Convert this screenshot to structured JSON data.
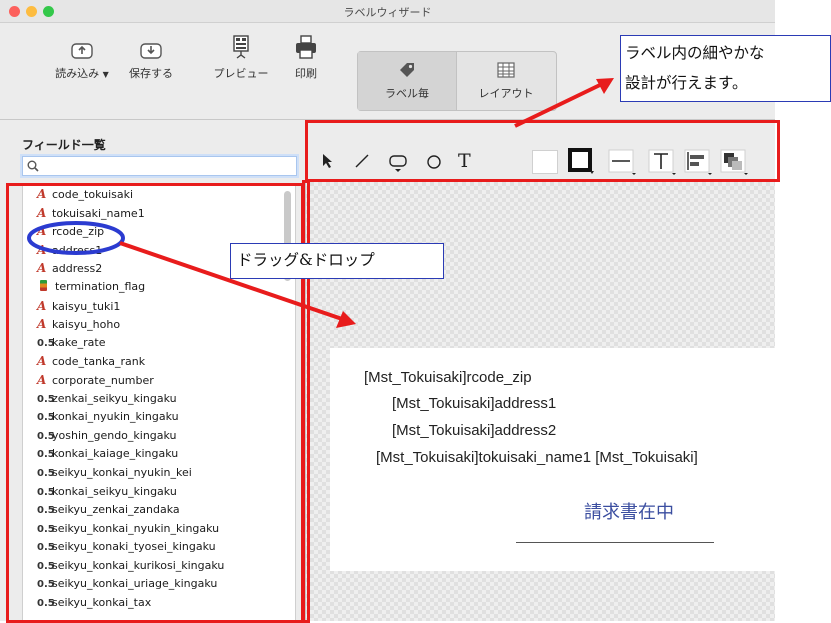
{
  "window": {
    "title": "ラベルウィザード",
    "traffic_lights": [
      "#fc605c",
      "#fdbc40",
      "#34c84a"
    ]
  },
  "toolbar": {
    "load_label": "読み込み",
    "save_label": "保存する",
    "preview_label": "プレビュー",
    "print_label": "印刷",
    "per_label_label": "ラベル毎",
    "layout_label": "レイアウト"
  },
  "sidebar": {
    "title": "フィールド一覧",
    "search_placeholder": "",
    "fields": [
      {
        "name": "code_tokuisaki",
        "icon": "A"
      },
      {
        "name": "tokuisaki_name1",
        "icon": "A"
      },
      {
        "name": "rcode_zip",
        "icon": "A"
      },
      {
        "name": "address1",
        "icon": "A"
      },
      {
        "name": "address2",
        "icon": "A"
      },
      {
        "name": "termination_flag",
        "icon": "flag"
      },
      {
        "name": "kaisyu_tuki1",
        "icon": "A"
      },
      {
        "name": "kaisyu_hoho",
        "icon": "A"
      },
      {
        "name": "kake_rate",
        "icon": "0.5"
      },
      {
        "name": "code_tanka_rank",
        "icon": "A"
      },
      {
        "name": "corporate_number",
        "icon": "A"
      },
      {
        "name": "zenkai_seikyu_kingaku",
        "icon": "0.5"
      },
      {
        "name": "konkai_nyukin_kingaku",
        "icon": "0.5"
      },
      {
        "name": "yoshin_gendo_kingaku",
        "icon": "0.5"
      },
      {
        "name": "konkai_kaiage_kingaku",
        "icon": "0.5"
      },
      {
        "name": "seikyu_konkai_nyukin_kei",
        "icon": "0.5"
      },
      {
        "name": "konkai_seikyu_kingaku",
        "icon": "0.5"
      },
      {
        "name": "seikyu_zenkai_zandaka",
        "icon": "0.5"
      },
      {
        "name": "seikyu_konkai_nyukin_kingaku",
        "icon": "0.5"
      },
      {
        "name": "seikyu_konaki_tyosei_kingaku",
        "icon": "0.5"
      },
      {
        "name": "seikyu_konkai_kurikosi_kingaku",
        "icon": "0.5"
      },
      {
        "name": "seikyu_konkai_uriage_kingaku",
        "icon": "0.5"
      },
      {
        "name": "seikyu_konkai_tax",
        "icon": "0.5"
      }
    ]
  },
  "shape_tools": {
    "text_tool_label": "T"
  },
  "label_preview": {
    "line1": "[Mst_Tokuisaki]rcode_zip",
    "line2": "[Mst_Tokuisaki]address1",
    "line3": "[Mst_Tokuisaki]address2",
    "line4": "[Mst_Tokuisaki]tokuisaki_name1 [Mst_Tokuisaki]",
    "stamp": "請求書在中"
  },
  "annotations": {
    "callout_design_line1": "ラベル内の細やかな",
    "callout_design_line2": "設計が行えます。",
    "callout_drag": "ドラッグ&ドロップ",
    "highlight_color": "#e81c1c",
    "callout_border_color": "#2b3bb5"
  }
}
